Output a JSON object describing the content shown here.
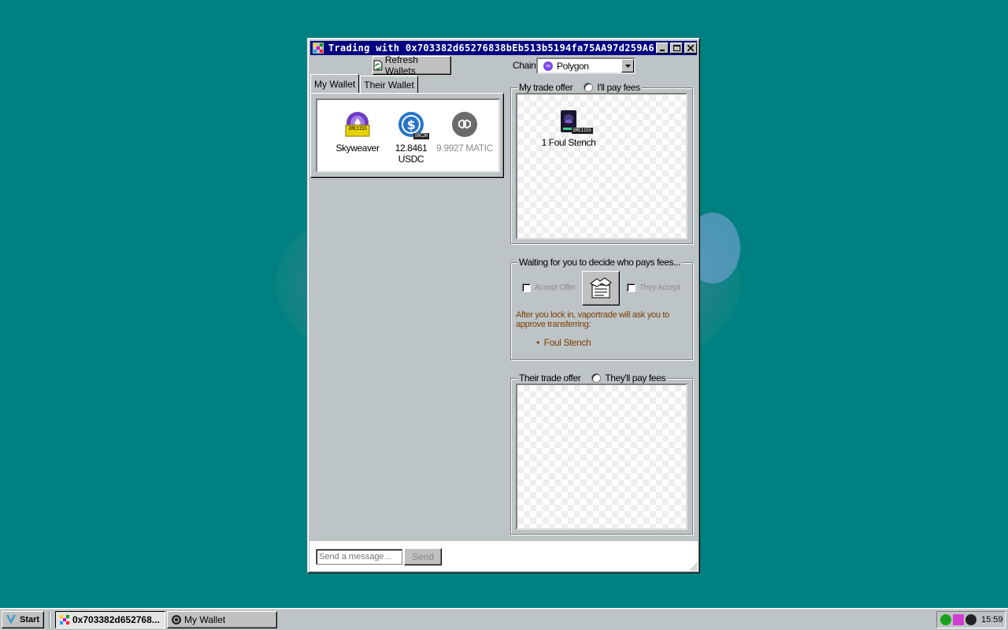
{
  "window": {
    "title": "Trading with 0x703382d65276838bEb513b5194fa75AA97d259A6",
    "refresh_label": "Refresh Wallets"
  },
  "tabs": [
    {
      "label": "My Wallet",
      "active": true
    },
    {
      "label": "Their Wallet",
      "active": false
    }
  ],
  "wallet": {
    "assets": [
      {
        "label": "Skyweaver",
        "badge": "ERC1155",
        "icon": "skyweaver-icon"
      },
      {
        "label": "12.8461 USDC",
        "badge": "ERC20",
        "icon": "usdc-icon"
      },
      {
        "label": "9.9927 MATIC",
        "badge": "",
        "icon": "polygon-icon"
      }
    ]
  },
  "chain": {
    "label": "Chain:",
    "selected": "Polygon",
    "color": "#8247e5"
  },
  "my_offer": {
    "title": "My trade offer",
    "fee_option": "I'll pay fees",
    "items": [
      {
        "label": "1 Foul Stench",
        "badge": "ERC1155"
      }
    ]
  },
  "status": {
    "title": "Waiting for you to decide who pays fees...",
    "accept_label": "Accept Offer",
    "they_accept_label": "They Accept",
    "note": "After you lock in, vaportrade will ask you to approve transferring:",
    "transfer_items": [
      "Foul Stench"
    ]
  },
  "their_offer": {
    "title": "Their trade offer",
    "fee_option": "They'll pay fees"
  },
  "message": {
    "placeholder": "Send a message...",
    "send_label": "Send"
  },
  "taskbar": {
    "start_label": "Start",
    "items": [
      {
        "label": "0x703382d652768...",
        "active": true
      },
      {
        "label": "My Wallet",
        "active": false
      }
    ],
    "clock": "15:59"
  },
  "colors": {
    "desktop": "#008080",
    "titlebar": "#000080",
    "note_text": "#7a3d00"
  }
}
